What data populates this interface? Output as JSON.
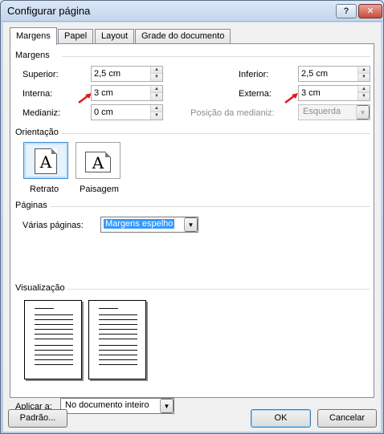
{
  "window": {
    "title": "Configurar página",
    "help_button": "?",
    "close_button": "✕"
  },
  "tabs": [
    {
      "label": "Margens",
      "active": true
    },
    {
      "label": "Papel",
      "active": false
    },
    {
      "label": "Layout",
      "active": false
    },
    {
      "label": "Grade do documento",
      "active": false
    }
  ],
  "margins": {
    "group_label": "Margens",
    "superior": {
      "label": "Superior:",
      "value": "2,5 cm"
    },
    "inferior": {
      "label": "Inferior:",
      "value": "2,5 cm"
    },
    "interna": {
      "label": "Interna:",
      "value": "3 cm"
    },
    "externa": {
      "label": "Externa:",
      "value": "3 cm"
    },
    "medianiz": {
      "label": "Medianiz:",
      "value": "0 cm"
    },
    "posicao_medianiz": {
      "label": "Posição da medianiz:",
      "value": "Esquerda"
    }
  },
  "orientation": {
    "group_label": "Orientação",
    "retrato": {
      "label": "Retrato",
      "icon_letter": "A"
    },
    "paisagem": {
      "label": "Paisagem",
      "icon_letter": "A"
    }
  },
  "pages": {
    "group_label": "Páginas",
    "varias_paginas_label": "Várias páginas:",
    "varias_paginas_value": "Margens espelho"
  },
  "preview": {
    "group_label": "Visualização"
  },
  "apply": {
    "label": "Aplicar a:",
    "value": "No documento inteiro"
  },
  "buttons": {
    "padrao": "Padrão...",
    "ok": "OK",
    "cancelar": "Cancelar"
  },
  "colors": {
    "selection": "#3399ff",
    "annotation_arrow": "#e0191b"
  }
}
